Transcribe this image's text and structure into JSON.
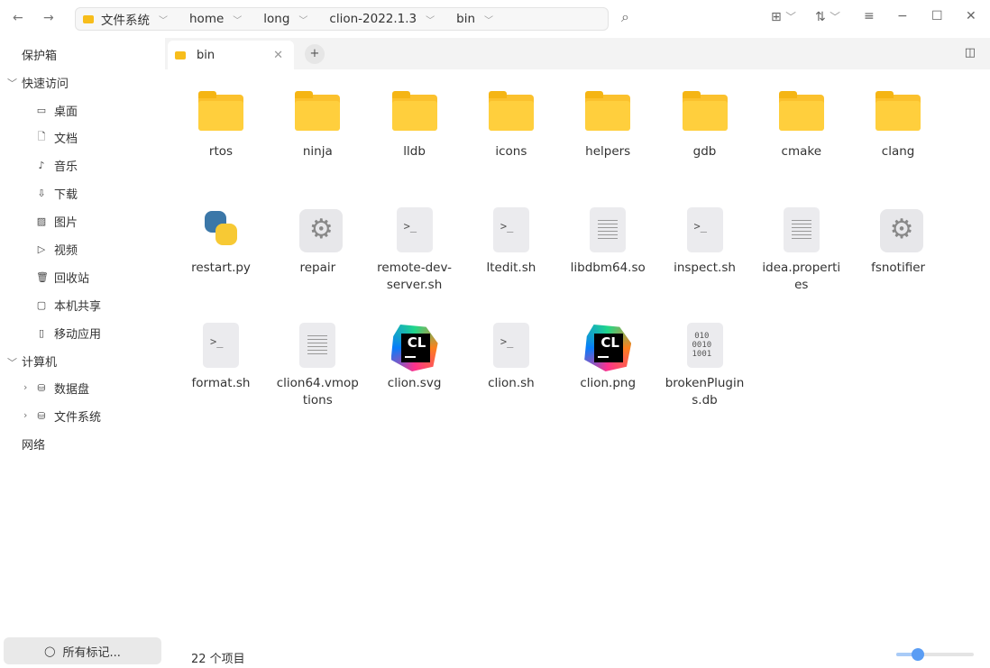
{
  "toolbar": {
    "back": "←",
    "forward": "→",
    "breadcrumbs": [
      "文件系统",
      "home",
      "long",
      "clion-2022.1.3",
      "bin"
    ]
  },
  "sidebar": {
    "vault": "保护箱",
    "quick_access": "快速访问",
    "quick_items": [
      {
        "icon": "desktop-icon",
        "glyph": "▭",
        "label": "桌面"
      },
      {
        "icon": "document-icon",
        "glyph": "🗋",
        "label": "文档"
      },
      {
        "icon": "music-icon",
        "glyph": "♪",
        "label": "音乐"
      },
      {
        "icon": "download-icon",
        "glyph": "⇩",
        "label": "下载"
      },
      {
        "icon": "picture-icon",
        "glyph": "▨",
        "label": "图片"
      },
      {
        "icon": "video-icon",
        "glyph": "▷",
        "label": "视频"
      },
      {
        "icon": "trash-icon",
        "glyph": "🗑",
        "label": "回收站"
      },
      {
        "icon": "folder-icon",
        "glyph": "▢",
        "label": "本机共享"
      },
      {
        "icon": "phone-icon",
        "glyph": "▯",
        "label": "移动应用"
      }
    ],
    "computer": "计算机",
    "computer_items": [
      {
        "label": "数据盘"
      },
      {
        "label": "文件系统"
      }
    ],
    "network": "网络",
    "tags": "所有标记..."
  },
  "tab": {
    "label": "bin",
    "add": "+"
  },
  "files": [
    {
      "name": "rtos",
      "type": "folder"
    },
    {
      "name": "ninja",
      "type": "folder"
    },
    {
      "name": "lldb",
      "type": "folder"
    },
    {
      "name": "icons",
      "type": "folder"
    },
    {
      "name": "helpers",
      "type": "folder"
    },
    {
      "name": "gdb",
      "type": "folder"
    },
    {
      "name": "cmake",
      "type": "folder"
    },
    {
      "name": "clang",
      "type": "folder"
    },
    {
      "name": "restart.py",
      "type": "python"
    },
    {
      "name": "repair",
      "type": "executable"
    },
    {
      "name": "remote-dev-server.sh",
      "type": "script"
    },
    {
      "name": "ltedit.sh",
      "type": "script"
    },
    {
      "name": "libdbm64.so",
      "type": "text"
    },
    {
      "name": "inspect.sh",
      "type": "script"
    },
    {
      "name": "idea.properties",
      "type": "text"
    },
    {
      "name": "fsnotifier",
      "type": "executable"
    },
    {
      "name": "format.sh",
      "type": "script"
    },
    {
      "name": "clion64.vmoptions",
      "type": "text"
    },
    {
      "name": "clion.svg",
      "type": "clion"
    },
    {
      "name": "clion.sh",
      "type": "script"
    },
    {
      "name": "clion.png",
      "type": "clion"
    },
    {
      "name": "brokenPlugins.db",
      "type": "binary"
    }
  ],
  "script_glyph": ">_",
  "binary_glyph": "010\n0010\n1001",
  "clion_glyph": "CL",
  "status": {
    "count": "22 个项目",
    "zoom_level": 0.28
  }
}
